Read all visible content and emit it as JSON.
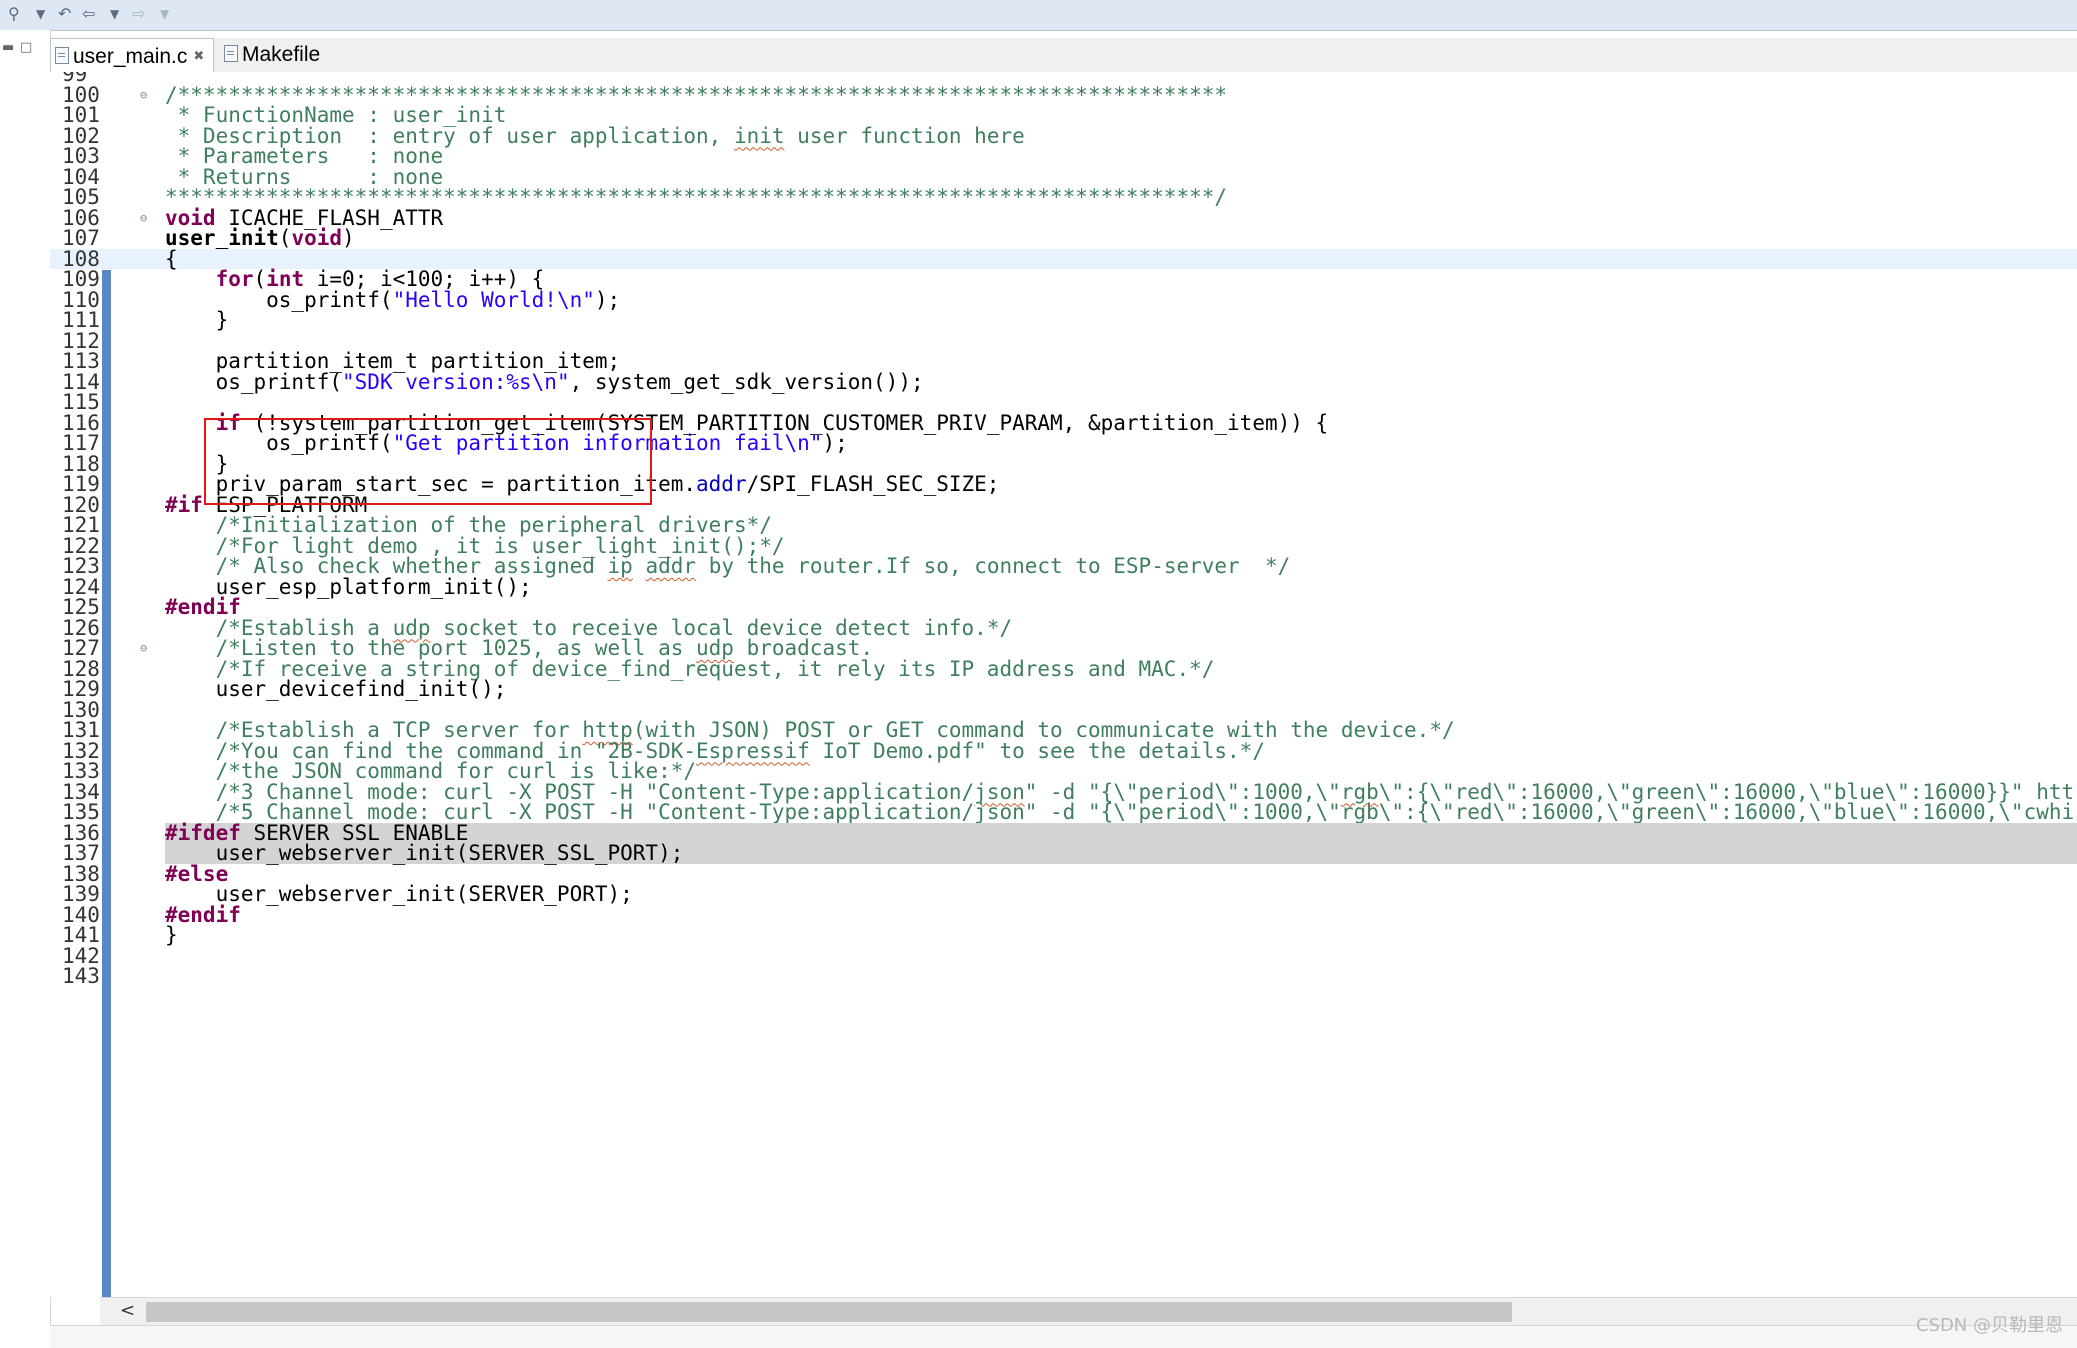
{
  "tabs": [
    {
      "label": "user_main.c",
      "active": true,
      "close": "✖"
    },
    {
      "label": "Makefile",
      "active": false
    }
  ],
  "lines": [
    {
      "n": "99",
      "segs": []
    },
    {
      "n": "100",
      "fold": "⊖",
      "segs": [
        {
          "t": "/***********************************************************************************",
          "c": "cm"
        }
      ]
    },
    {
      "n": "101",
      "segs": [
        {
          "t": " * FunctionName : user_init",
          "c": "cm"
        }
      ]
    },
    {
      "n": "102",
      "segs": [
        {
          "t": " * Description  : entry of user application, ",
          "c": "cm"
        },
        {
          "t": "init",
          "c": "cm squig"
        },
        {
          "t": " user function here",
          "c": "cm"
        }
      ]
    },
    {
      "n": "103",
      "segs": [
        {
          "t": " * Parameters   : none",
          "c": "cm"
        }
      ]
    },
    {
      "n": "104",
      "segs": [
        {
          "t": " * Returns      : none",
          "c": "cm"
        }
      ]
    },
    {
      "n": "105",
      "segs": [
        {
          "t": "***********************************************************************************/",
          "c": "cm"
        }
      ]
    },
    {
      "n": "106",
      "fold": "⊖",
      "segs": [
        {
          "t": "void",
          "c": "kw"
        },
        {
          "t": " ICACHE_FLASH_ATTR"
        }
      ]
    },
    {
      "n": "107",
      "segs": [
        {
          "t": "user_init",
          "c": "bf"
        },
        {
          "t": "("
        },
        {
          "t": "void",
          "c": "kw"
        },
        {
          "t": ")"
        }
      ]
    },
    {
      "n": "108",
      "cur": true,
      "segs": [
        {
          "t": "{"
        }
      ]
    },
    {
      "n": "109",
      "segs": [
        {
          "t": "    "
        },
        {
          "t": "for",
          "c": "kw"
        },
        {
          "t": "("
        },
        {
          "t": "int",
          "c": "kw"
        },
        {
          "t": " i=0; i<100; i++) {"
        }
      ]
    },
    {
      "n": "110",
      "segs": [
        {
          "t": "        os_printf("
        },
        {
          "t": "\"Hello World!\\n\"",
          "c": "st"
        },
        {
          "t": ");"
        }
      ]
    },
    {
      "n": "111",
      "segs": [
        {
          "t": "    }"
        }
      ]
    },
    {
      "n": "112",
      "segs": []
    },
    {
      "n": "113",
      "segs": [
        {
          "t": "    partition_item_t partition_item;"
        }
      ]
    },
    {
      "n": "114",
      "segs": [
        {
          "t": "    os_printf("
        },
        {
          "t": "\"SDK version:%s\\n\"",
          "c": "st"
        },
        {
          "t": ", system_get_sdk_version());"
        }
      ]
    },
    {
      "n": "115",
      "segs": []
    },
    {
      "n": "116",
      "segs": [
        {
          "t": "    "
        },
        {
          "t": "if",
          "c": "kw"
        },
        {
          "t": " (!system_partition_get_item(SYSTEM_PARTITION_CUSTOMER_PRIV_PARAM, &partition_item)) {"
        }
      ]
    },
    {
      "n": "117",
      "segs": [
        {
          "t": "        os_printf("
        },
        {
          "t": "\"Get partition information fail\\n\"",
          "c": "st"
        },
        {
          "t": ");"
        }
      ]
    },
    {
      "n": "118",
      "segs": [
        {
          "t": "    }"
        }
      ]
    },
    {
      "n": "119",
      "segs": [
        {
          "t": "    priv_param_start_sec = partition_item."
        },
        {
          "t": "addr",
          "c": "fl"
        },
        {
          "t": "/SPI_FLASH_SEC_SIZE;"
        }
      ]
    },
    {
      "n": "120",
      "segs": [
        {
          "t": "#if",
          "c": "pp"
        },
        {
          "t": " ESP_PLATFORM"
        }
      ]
    },
    {
      "n": "121",
      "segs": [
        {
          "t": "    "
        },
        {
          "t": "/*Initialization of the peripheral drivers*/",
          "c": "cm"
        }
      ]
    },
    {
      "n": "122",
      "segs": [
        {
          "t": "    "
        },
        {
          "t": "/*For light demo , it is user_light_init();*/",
          "c": "cm"
        }
      ]
    },
    {
      "n": "123",
      "segs": [
        {
          "t": "    "
        },
        {
          "t": "/* Also check whether assigned ",
          "c": "cm"
        },
        {
          "t": "ip",
          "c": "cm squig"
        },
        {
          "t": " ",
          "c": "cm"
        },
        {
          "t": "addr",
          "c": "cm squig"
        },
        {
          "t": " by the router.If so, connect to ESP-server  */",
          "c": "cm"
        }
      ]
    },
    {
      "n": "124",
      "segs": [
        {
          "t": "    user_esp_platform_init();"
        }
      ]
    },
    {
      "n": "125",
      "segs": [
        {
          "t": "#endif",
          "c": "pp"
        }
      ]
    },
    {
      "n": "126",
      "segs": [
        {
          "t": "    "
        },
        {
          "t": "/*Establish a ",
          "c": "cm"
        },
        {
          "t": "udp",
          "c": "cm squig"
        },
        {
          "t": " socket to receive local device detect info.*/",
          "c": "cm"
        }
      ]
    },
    {
      "n": "127",
      "fold": "⊖",
      "segs": [
        {
          "t": "    "
        },
        {
          "t": "/*Listen to the port 1025, as well as ",
          "c": "cm"
        },
        {
          "t": "udp",
          "c": "cm squig"
        },
        {
          "t": " broadcast.",
          "c": "cm"
        }
      ]
    },
    {
      "n": "128",
      "segs": [
        {
          "t": "    "
        },
        {
          "t": "/*If receive a string of device_find_request, it rely its IP address and MAC.*/",
          "c": "cm"
        }
      ]
    },
    {
      "n": "129",
      "segs": [
        {
          "t": "    user_devicefind_init();"
        }
      ]
    },
    {
      "n": "130",
      "segs": []
    },
    {
      "n": "131",
      "segs": [
        {
          "t": "    "
        },
        {
          "t": "/*Establish a TCP server for ",
          "c": "cm"
        },
        {
          "t": "http",
          "c": "cm squig"
        },
        {
          "t": "(with JSON) POST or GET command to communicate with the device.*/",
          "c": "cm"
        }
      ]
    },
    {
      "n": "132",
      "segs": [
        {
          "t": "    "
        },
        {
          "t": "/*You can find the command in \"2B-SDK-",
          "c": "cm"
        },
        {
          "t": "Espressif",
          "c": "cm squig"
        },
        {
          "t": " IoT Demo.pdf\" to see the details.*/",
          "c": "cm"
        }
      ]
    },
    {
      "n": "133",
      "segs": [
        {
          "t": "    "
        },
        {
          "t": "/*the JSON command for curl is like:*/",
          "c": "cm"
        }
      ]
    },
    {
      "n": "134",
      "segs": [
        {
          "t": "    "
        },
        {
          "t": "/*3 Channel mode: curl -X POST -H \"Content-Type:application/",
          "c": "cm"
        },
        {
          "t": "json",
          "c": "cm squig"
        },
        {
          "t": "\" -d \"{\\\"period\\\":1000,\\\"",
          "c": "cm"
        },
        {
          "t": "rgb",
          "c": "cm squig"
        },
        {
          "t": "\\\":{\\\"red\\\":16000,\\\"green\\\":16000,\\\"blue\\\":16000}}\" htt",
          "c": "cm"
        }
      ]
    },
    {
      "n": "135",
      "segs": [
        {
          "t": "    "
        },
        {
          "t": "/*5 Channel mode: curl -X POST -H \"Content-Type:application/",
          "c": "cm"
        },
        {
          "t": "json",
          "c": "cm squig"
        },
        {
          "t": "\" -d \"{\\\"period\\\":1000,\\\"",
          "c": "cm"
        },
        {
          "t": "rgb",
          "c": "cm squig"
        },
        {
          "t": "\\\":{\\\"red\\\":16000,\\\"green\\\":16000,\\\"blue\\\":16000,\\\"",
          "c": "cm"
        },
        {
          "t": "cwhi",
          "c": "cm squig"
        }
      ]
    },
    {
      "n": "136",
      "hl": true,
      "segs": [
        {
          "t": "#ifdef",
          "c": "pp"
        },
        {
          "t": " SERVER_SSL_ENABLE"
        }
      ]
    },
    {
      "n": "137",
      "hl": true,
      "segs": [
        {
          "t": "    user_webserver_init(SERVER_SSL_PORT);"
        }
      ]
    },
    {
      "n": "138",
      "segs": [
        {
          "t": "#else",
          "c": "pp"
        }
      ]
    },
    {
      "n": "139",
      "segs": [
        {
          "t": "    user_webserver_init(SERVER_PORT);"
        }
      ]
    },
    {
      "n": "140",
      "segs": [
        {
          "t": "#endif",
          "c": "pp"
        }
      ]
    },
    {
      "n": "141",
      "segs": [
        {
          "t": "}"
        }
      ]
    },
    {
      "n": "142",
      "segs": []
    },
    {
      "n": "143",
      "segs": []
    }
  ],
  "scrollbar": {
    "left_arrow": "<"
  },
  "watermark": "CSDN @贝勒里恩",
  "colors": {
    "comment": "#3f7f5f",
    "keyword": "#7f0055",
    "string": "#2a00ff",
    "field": "#0000c0",
    "annotation_box": "#e01818",
    "change_bar": "#5b87c7"
  }
}
